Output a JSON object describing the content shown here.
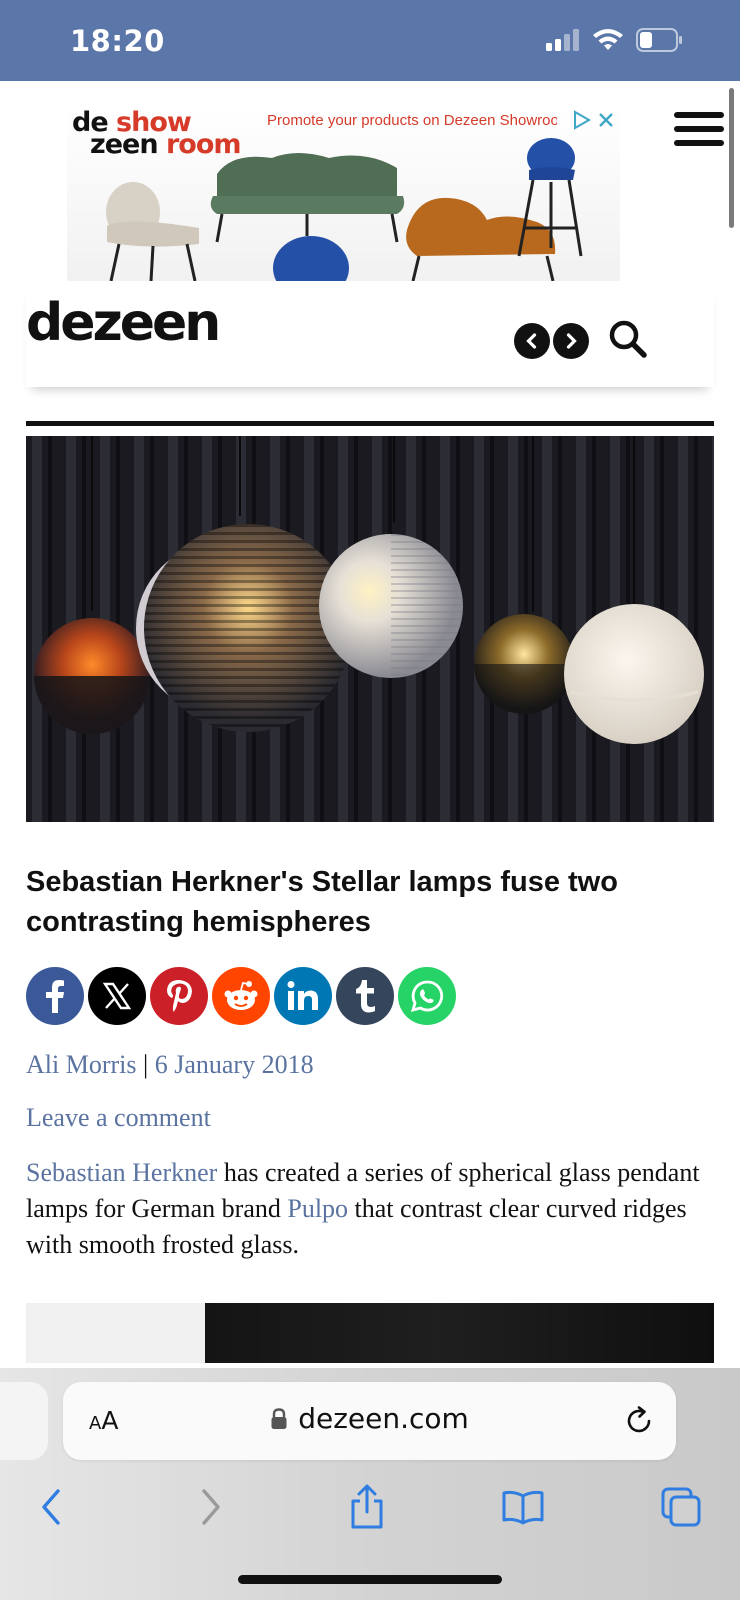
{
  "status_bar": {
    "time": "18:20",
    "icons": [
      "signal-icon",
      "wifi-icon",
      "battery-icon"
    ]
  },
  "ad": {
    "logo_line1_a": "de",
    "logo_line1_b": "show",
    "logo_line2_a": "zeen",
    "logo_line2_b": "room",
    "headline": "Promote your products on Dezeen Showroom",
    "icons": [
      "adchoices-icon",
      "close-icon"
    ]
  },
  "site": {
    "logo": "dezeen",
    "icons": [
      "menu-icon",
      "chevron-left-icon",
      "chevron-right-icon",
      "search-icon"
    ]
  },
  "article": {
    "title": "Sebastian Herkner's Stellar lamps fuse two contrasting hemispheres",
    "author": "Ali Morris",
    "separator": " | ",
    "date": "6 January 2018",
    "comment_link": "Leave a comment",
    "body_link1": "Sebastian Herkner",
    "body_text1": " has created a series of spherical glass pendant lamps for German brand ",
    "body_link2": "Pulpo",
    "body_text2": " that contrast clear curved ridges with smooth frosted glass."
  },
  "share": [
    {
      "network": "facebook",
      "icon": "facebook-icon",
      "color": "#3b5998"
    },
    {
      "network": "x",
      "icon": "x-icon",
      "color": "#000000"
    },
    {
      "network": "pinterest",
      "icon": "pinterest-icon",
      "color": "#cb2027"
    },
    {
      "network": "reddit",
      "icon": "reddit-icon",
      "color": "#ff4500"
    },
    {
      "network": "linkedin",
      "icon": "linkedin-icon",
      "color": "#0077b5"
    },
    {
      "network": "tumblr",
      "icon": "tumblr-icon",
      "color": "#35465c"
    },
    {
      "network": "whatsapp",
      "icon": "whatsapp-icon",
      "color": "#25d366"
    }
  ],
  "browser": {
    "text_size_small": "A",
    "text_size_big": "A",
    "url": "dezeen.com",
    "icons": [
      "lock-icon",
      "reload-icon",
      "back-icon",
      "forward-icon",
      "share-icon",
      "bookmarks-icon",
      "tabs-icon"
    ]
  },
  "colors": {
    "status_bar": "#5b76a8",
    "link": "#5a73a0",
    "ad_accent": "#d63a28"
  }
}
